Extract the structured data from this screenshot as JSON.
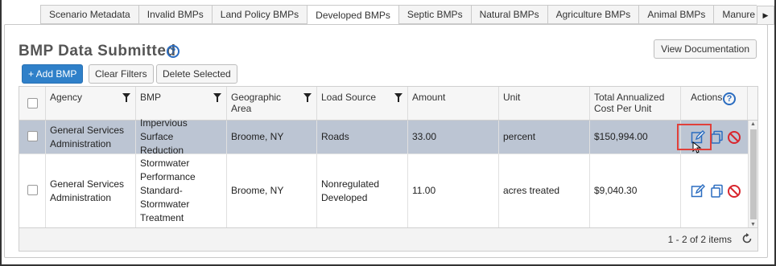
{
  "tabs": [
    {
      "label": "Scenario Metadata",
      "active": false
    },
    {
      "label": "Invalid BMPs",
      "active": false
    },
    {
      "label": "Land Policy BMPs",
      "active": false
    },
    {
      "label": "Developed BMPs",
      "active": true
    },
    {
      "label": "Septic BMPs",
      "active": false
    },
    {
      "label": "Natural BMPs",
      "active": false
    },
    {
      "label": "Agriculture BMPs",
      "active": false
    },
    {
      "label": "Animal BMPs",
      "active": false
    },
    {
      "label": "Manure Treatment BM",
      "active": false
    }
  ],
  "tab_next_icon": "triangle-right-icon",
  "panel": {
    "title": "BMP Data Submitted",
    "view_doc_label": "View Documentation",
    "toolbar": {
      "add_label": "+ Add BMP",
      "clear_label": "Clear Filters",
      "delete_label": "Delete Selected"
    }
  },
  "columns": {
    "agency": "Agency",
    "bmp": "BMP",
    "geo1": "Geographic",
    "geo2": "Area",
    "load_source": "Load Source",
    "amount": "Amount",
    "unit": "Unit",
    "cost1": "Total Annualized",
    "cost2": "Cost Per Unit",
    "actions": "Actions"
  },
  "rows": [
    {
      "agency1": "General Services",
      "agency2": "Administration",
      "bmp": [
        "Impervious Surface",
        "Reduction"
      ],
      "geo": "Broome, NY",
      "load_source": [
        "Roads"
      ],
      "amount": "33.00",
      "unit": "percent",
      "cost": "$150,994.00",
      "selected": true
    },
    {
      "agency1": "General Services",
      "agency2": "Administration",
      "bmp": [
        "Stormwater",
        "Performance",
        "Standard-",
        "Stormwater",
        "Treatment"
      ],
      "geo": "Broome, NY",
      "load_source": [
        "Nonregulated",
        "Developed"
      ],
      "amount": "11.00",
      "unit": "acres treated",
      "cost": "$9,040.30",
      "selected": false
    }
  ],
  "pager": {
    "text": "1 - 2 of 2 items"
  },
  "colors": {
    "accent": "#2f80c9",
    "selected_row": "#bcc5d3",
    "delete": "#d9262e",
    "highlight": "#e0403a"
  }
}
